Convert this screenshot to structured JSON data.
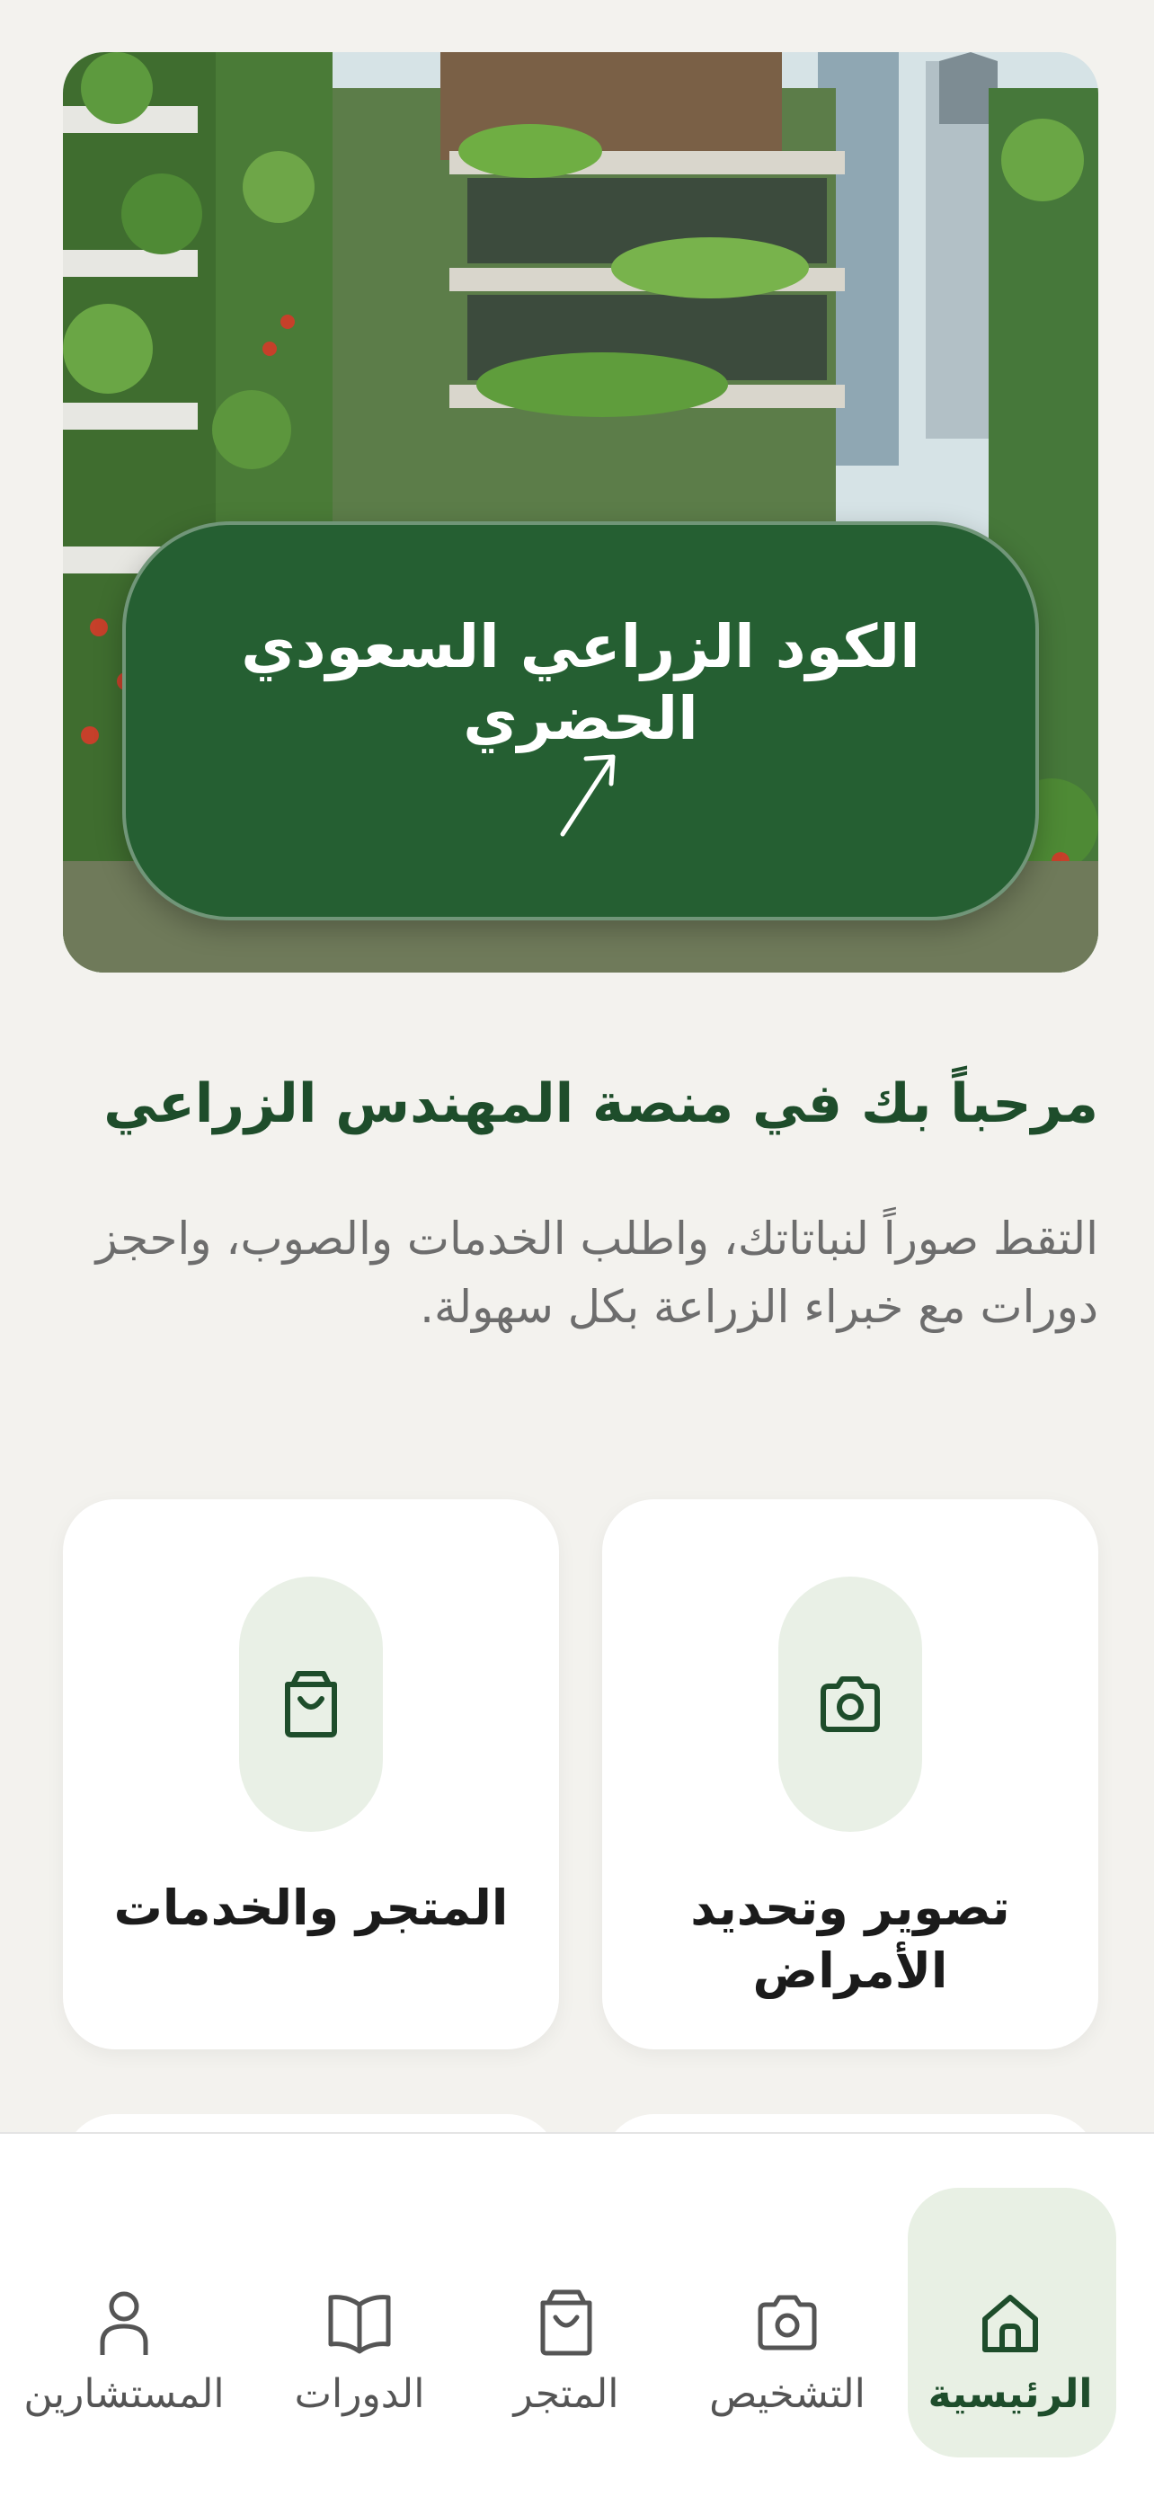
{
  "banner": {
    "title": "الكود الزراعي السعودي الحضري",
    "arrow_icon": "arrow-up-right-icon"
  },
  "welcome": {
    "title": "مرحباً بك في منصة المهندس الزراعي",
    "description": "التقط صوراً لنباتاتك، واطلب الخدمات والصوب، واحجز دورات مع خبراء الزراعة بكل سهولة."
  },
  "features": [
    {
      "label": "تصوير وتحديد الأمراض",
      "icon": "camera-icon"
    },
    {
      "label": "المتجر والخدمات",
      "icon": "shopping-bag-icon"
    }
  ],
  "nav": {
    "items": [
      {
        "label": "الرئيسية",
        "icon": "home-icon",
        "active": true
      },
      {
        "label": "التشخيص",
        "icon": "camera-icon",
        "active": false
      },
      {
        "label": "المتجر",
        "icon": "shopping-bag-icon",
        "active": false
      },
      {
        "label": "الدورات",
        "icon": "book-icon",
        "active": false
      },
      {
        "label": "المستشارين",
        "icon": "user-icon",
        "active": false
      }
    ]
  },
  "colors": {
    "brand_green": "#1e4d2b",
    "banner_card_green": "#255f32",
    "icon_circle_bg": "#e9f0e6",
    "page_bg": "#f3f2ee"
  }
}
